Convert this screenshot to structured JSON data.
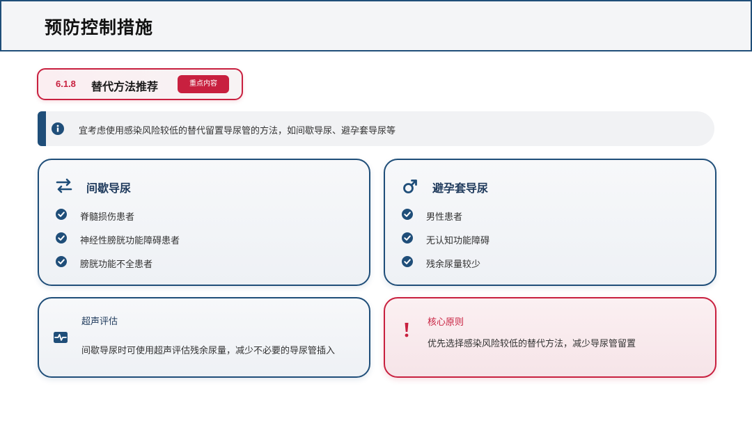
{
  "header": {
    "title": "预防控制措施"
  },
  "section": {
    "number": "6.1.8",
    "title": "替代方法推荐",
    "badge": "重点内容"
  },
  "info": {
    "icon": "info-icon",
    "text": "宜考虑使用感染风险较低的替代留置导尿管的方法，如间歇导尿、避孕套导尿等"
  },
  "methods": [
    {
      "icon": "exchange-arrows-icon",
      "title": "间歇导尿",
      "items": [
        "脊髓损伤患者",
        "神经性膀胱功能障碍患者",
        "膀胱功能不全患者"
      ]
    },
    {
      "icon": "male-symbol-icon",
      "title": "避孕套导尿",
      "items": [
        "男性患者",
        "无认知功能障碍",
        "残余尿量较少"
      ]
    }
  ],
  "ultrasound": {
    "icon": "heartbeat-monitor-icon",
    "title": "超声评估",
    "text": "间歇导尿时可使用超声评估残余尿量，减少不必要的导尿管插入"
  },
  "core": {
    "icon": "exclamation-icon",
    "title": "核心原则",
    "text": "优先选择感染风险较低的替代方法，减少导尿管留置"
  },
  "colors": {
    "primary": "#1f4e79",
    "accent": "#c8203f"
  }
}
